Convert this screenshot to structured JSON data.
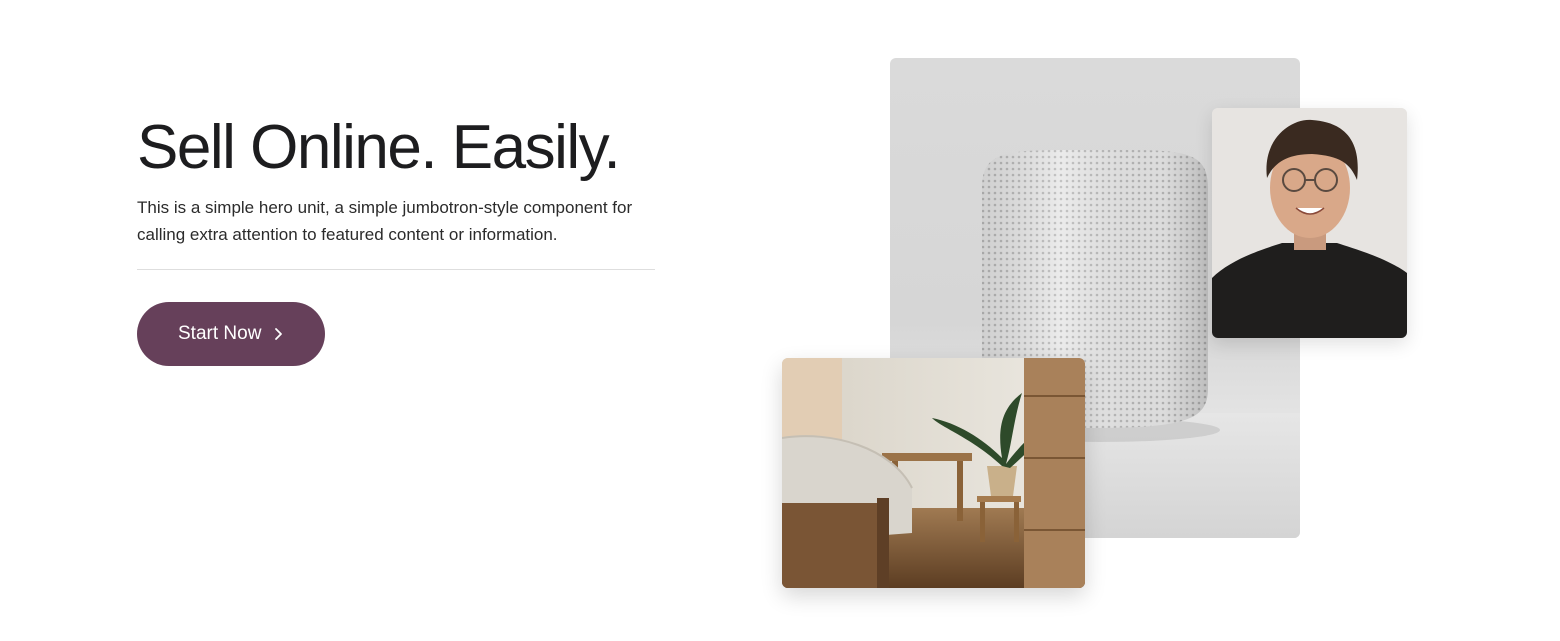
{
  "hero": {
    "title": "Sell Online. Easily.",
    "lead": "This is a simple hero unit, a simple jumbotron-style component for calling extra attention to featured content or information.",
    "cta_label": "Start Now",
    "cta_icon": "chevron-right-icon"
  },
  "images": [
    {
      "name": "smart-speaker-photo"
    },
    {
      "name": "person-portrait-photo"
    },
    {
      "name": "bedroom-interior-photo"
    }
  ],
  "colors": {
    "accent": "#66405a",
    "title": "#1d1d1f",
    "background": "#ffffff"
  }
}
